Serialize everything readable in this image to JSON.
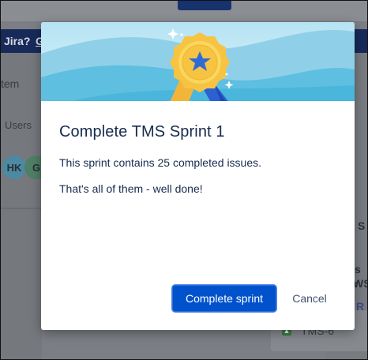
{
  "background": {
    "banner_text": "Jira?",
    "banner_link": "G",
    "sidebar_item": "tem",
    "users_label": "Users",
    "avatars": [
      "HK",
      "G"
    ],
    "right_texts": [
      "S",
      "s -",
      "WS",
      "R"
    ],
    "card_label": "TMS-6"
  },
  "dialog": {
    "title": "Complete TMS Sprint 1",
    "message_1": "This sprint contains 25 completed issues.",
    "message_2": "That's all of them - well done!",
    "primary_label": "Complete sprint",
    "cancel_label": "Cancel"
  },
  "colors": {
    "primary": "#0052cc",
    "title_text": "#172b4d",
    "hero_sky": "#c8ecf6",
    "badge_gold": "#f6c343",
    "badge_star": "#2f6bd8"
  },
  "icons": {
    "hero": "award-ribbon-icon"
  }
}
